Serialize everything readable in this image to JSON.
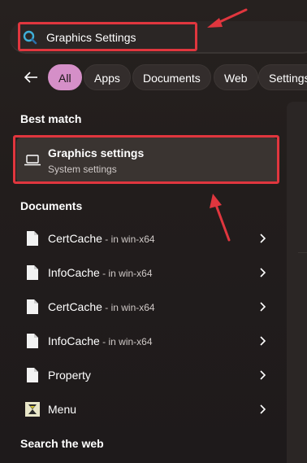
{
  "search": {
    "query": "Graphics Settings"
  },
  "filters": {
    "back_label": "Back",
    "chips": [
      {
        "label": "All",
        "active": true
      },
      {
        "label": "Apps",
        "active": false
      },
      {
        "label": "Documents",
        "active": false
      },
      {
        "label": "Web",
        "active": false
      },
      {
        "label": "Settings",
        "active": false
      }
    ]
  },
  "best_match": {
    "heading": "Best match",
    "title": "Graphics settings",
    "subtitle": "System settings",
    "icon": "laptop-icon"
  },
  "documents": {
    "heading": "Documents",
    "items": [
      {
        "name": "CertCache",
        "location": " - in win-x64",
        "icon": "document-icon"
      },
      {
        "name": "InfoCache",
        "location": " - in win-x64",
        "icon": "document-icon"
      },
      {
        "name": "CertCache",
        "location": " - in win-x64",
        "icon": "document-icon"
      },
      {
        "name": "InfoCache",
        "location": " - in win-x64",
        "icon": "document-icon"
      },
      {
        "name": "Property",
        "location": "",
        "icon": "document-icon"
      },
      {
        "name": "Menu",
        "location": "",
        "icon": "app-icon"
      }
    ]
  },
  "web": {
    "heading": "Search the web"
  },
  "colors": {
    "accent_chip": "#d58fc8",
    "annotation": "#e0363e",
    "search_icon": "#3fb0d9"
  }
}
